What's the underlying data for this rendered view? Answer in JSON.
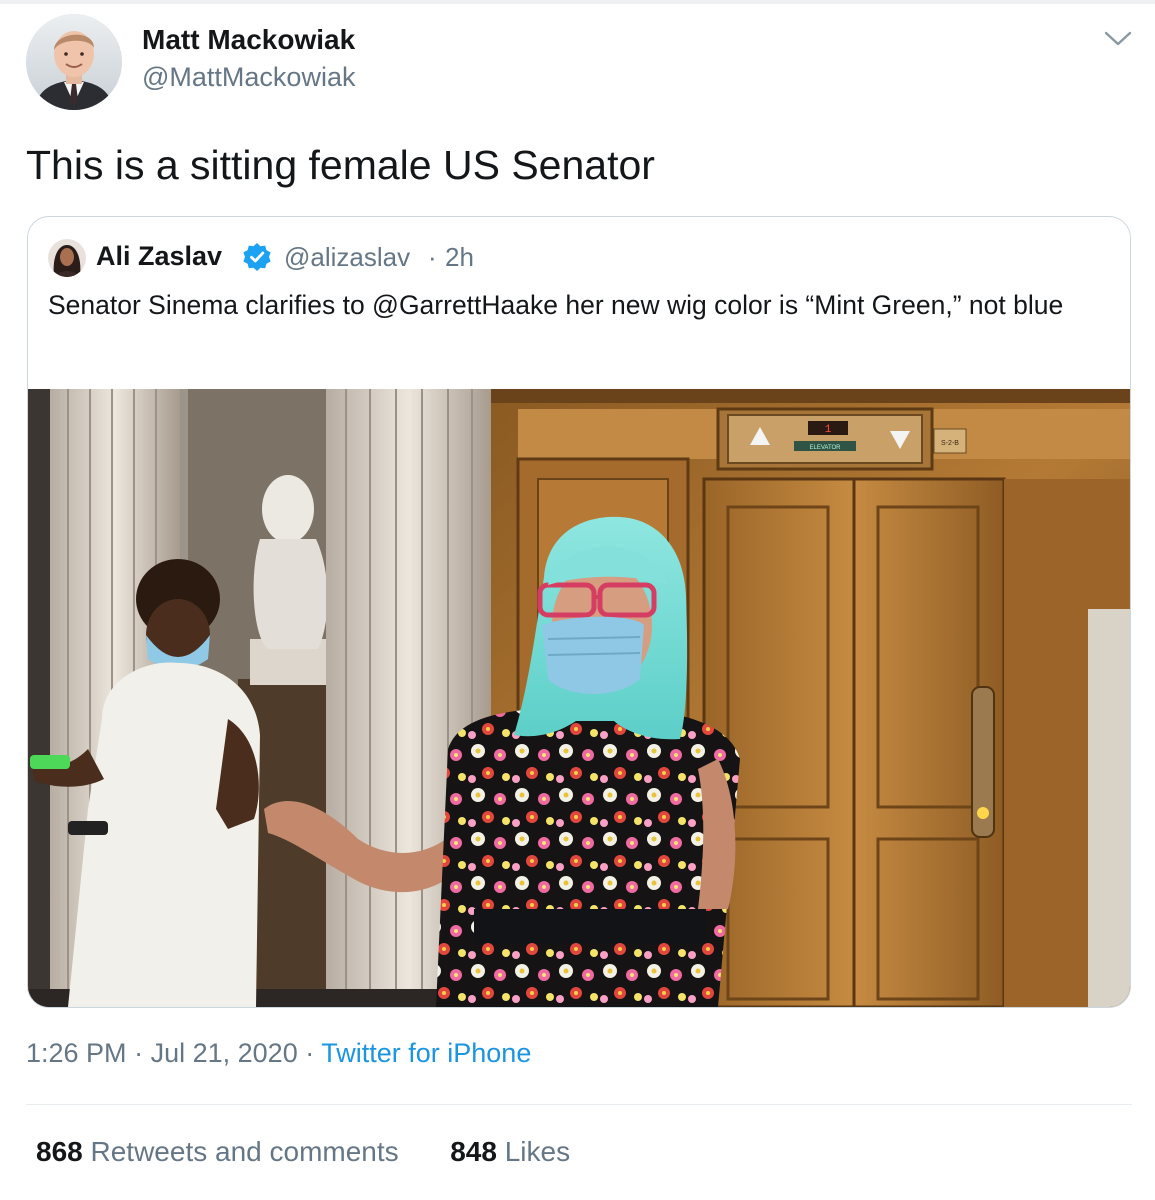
{
  "tweet": {
    "author_name": "Matt Mackowiak",
    "author_handle": "@MattMackowiak",
    "text": "This is a sitting female US Senator",
    "time": "1:26 PM",
    "date": "Jul 21, 2020",
    "separator": "·",
    "source": "Twitter for iPhone"
  },
  "quoted": {
    "author_name": "Ali Zaslav",
    "author_handle": "@alizaslav",
    "separator": "·",
    "age": "2h",
    "text": "Senator Sinema clarifies to @GarrettHaake her new wig color is “Mint Green,” not blue",
    "photo": {
      "elevator_floor_label": "1",
      "elevator_panel_label": "ELEVATOR",
      "elevator_side_label": "S-2-B"
    }
  },
  "stats": {
    "retweets_count": "868",
    "retweets_label": "Retweets and comments",
    "likes_count": "848",
    "likes_label": "Likes"
  },
  "colors": {
    "link": "#1b95e0",
    "secondary_text": "#657786",
    "primary_text": "#14171a",
    "verified": "#1da1f2",
    "wig": "#72dbd6"
  },
  "icons": {
    "caret": "chevron-down-icon",
    "verified": "verified-badge-icon"
  }
}
